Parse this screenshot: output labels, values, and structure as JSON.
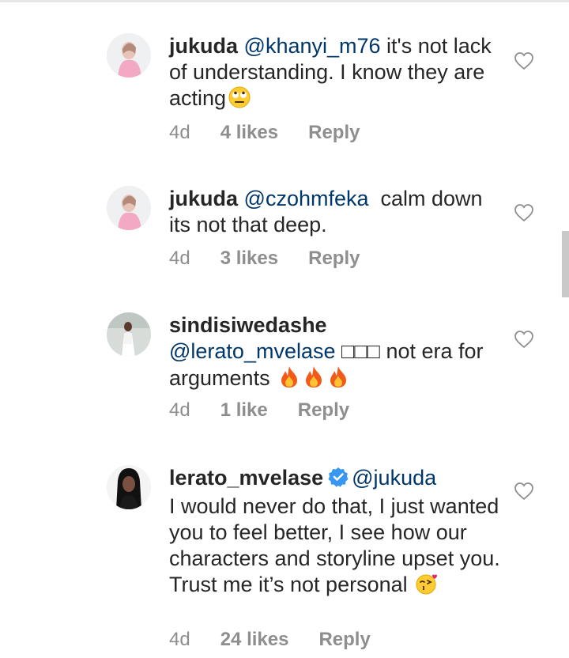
{
  "comments": [
    {
      "username": "jukuda",
      "mention": "@khanyi_m76",
      "text": " it's not lack of understanding. I know they are acting",
      "emoji_icon": "face-with-rolling-eyes",
      "time": "4d",
      "likes": "4 likes",
      "reply": "Reply",
      "verified": false
    },
    {
      "username": "jukuda",
      "mention": "@czohmfeka",
      "text": "  calm down its not that deep.",
      "time": "4d",
      "likes": "3 likes",
      "reply": "Reply",
      "verified": false
    },
    {
      "username": "sindisiwedashe",
      "mention": "@lerato_mvelase",
      "text": " □□□ not era for arguments ",
      "emoji_icon": "fire",
      "emoji_count": 3,
      "time": "4d",
      "likes": "1 like",
      "reply": "Reply",
      "verified": false
    },
    {
      "username": "lerato_mvelase",
      "mention": "@jukuda",
      "text": "I would never do that, I just wanted you to feel better, I see how our characters and storyline upset you. Trust me it’s not personal ",
      "emoji_icon": "face-blowing-a-kiss",
      "time": "4d",
      "likes": "24 likes",
      "reply": "Reply",
      "verified": true
    }
  ],
  "colors": {
    "text": "#262626",
    "mention": "#00376b",
    "meta": "#8e8e8e",
    "verified": "#3897f0",
    "divider": "#e6e6e6",
    "scrollbar": "#c9c9c9"
  },
  "icons": {
    "like": "heart-outline-icon",
    "verified": "verified-badge-icon"
  }
}
